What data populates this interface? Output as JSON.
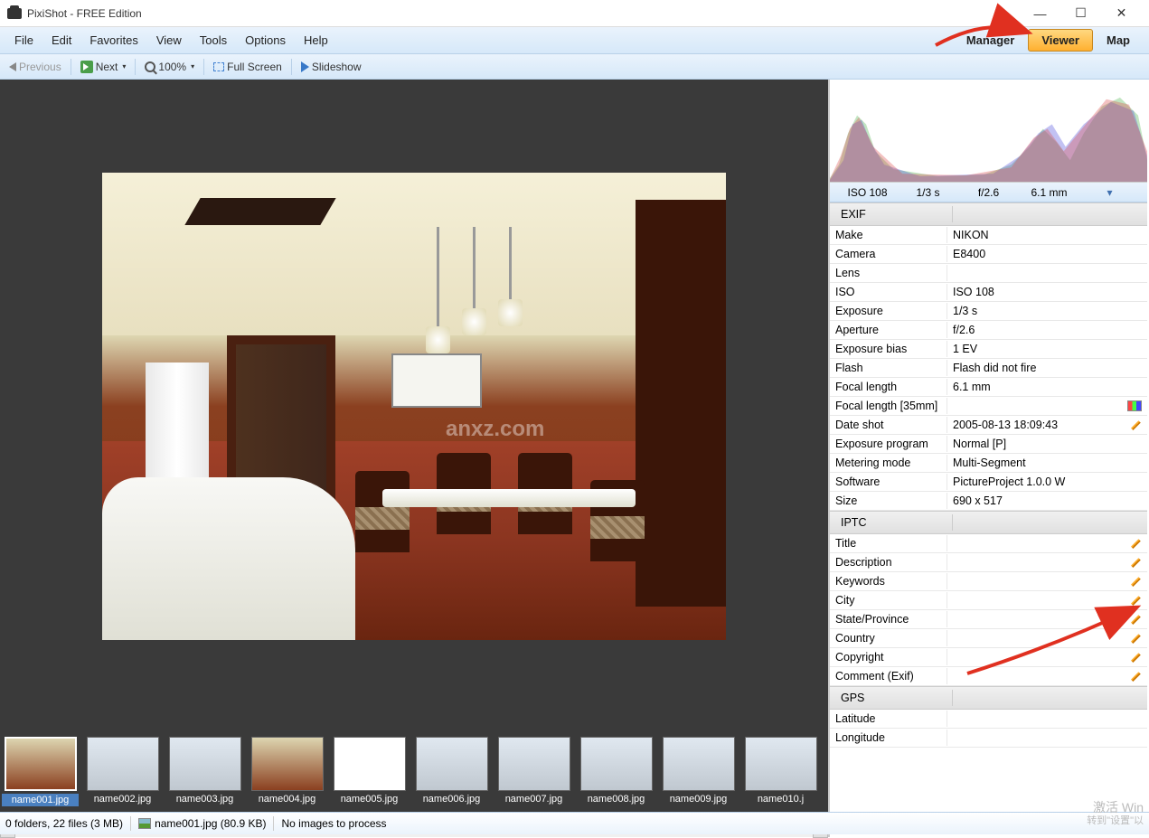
{
  "window": {
    "title": "PixiShot  -  FREE Edition"
  },
  "menu": {
    "items": [
      "File",
      "Edit",
      "Favorites",
      "View",
      "Tools",
      "Options",
      "Help"
    ]
  },
  "modes": {
    "manager": "Manager",
    "viewer": "Viewer",
    "map": "Map"
  },
  "toolbar": {
    "previous": "Previous",
    "next": "Next",
    "zoom": "100%",
    "fullscreen": "Full Screen",
    "slideshow": "Slideshow"
  },
  "exif_summary": {
    "iso": "ISO 108",
    "shutter": "1/3 s",
    "aperture": "f/2.6",
    "focal": "6.1 mm"
  },
  "metadata": {
    "sections": [
      {
        "name": "EXIF",
        "rows": [
          {
            "k": "Make",
            "v": "NIKON"
          },
          {
            "k": "Camera",
            "v": "E8400"
          },
          {
            "k": "Lens",
            "v": ""
          },
          {
            "k": "ISO",
            "v": "ISO 108"
          },
          {
            "k": "Exposure",
            "v": "1/3 s"
          },
          {
            "k": "Aperture",
            "v": "f/2.6"
          },
          {
            "k": "Exposure bias",
            "v": "1 EV"
          },
          {
            "k": "Flash",
            "v": "Flash did not fire"
          },
          {
            "k": "Focal length",
            "v": "6.1 mm"
          },
          {
            "k": "Focal length [35mm]",
            "v": "",
            "colorbox": true
          },
          {
            "k": "Date shot",
            "v": "2005-08-13 18:09:43",
            "edit": true
          },
          {
            "k": "Exposure program",
            "v": "Normal [P]"
          },
          {
            "k": "Metering mode",
            "v": "Multi-Segment"
          },
          {
            "k": "Software",
            "v": "PictureProject 1.0.0 W"
          },
          {
            "k": "Size",
            "v": "690 x 517"
          }
        ]
      },
      {
        "name": "IPTC",
        "rows": [
          {
            "k": "Title",
            "v": "",
            "edit": true
          },
          {
            "k": "Description",
            "v": "",
            "edit": true
          },
          {
            "k": "Keywords",
            "v": "",
            "edit": true
          },
          {
            "k": "City",
            "v": "",
            "edit": true
          },
          {
            "k": "State/Province",
            "v": "",
            "edit": true
          },
          {
            "k": "Country",
            "v": "",
            "edit": true
          },
          {
            "k": "Copyright",
            "v": "",
            "edit": true
          },
          {
            "k": "Comment (Exif)",
            "v": "",
            "edit": true
          }
        ]
      },
      {
        "name": "GPS",
        "rows": [
          {
            "k": "Latitude",
            "v": ""
          },
          {
            "k": "Longitude",
            "v": ""
          }
        ]
      }
    ]
  },
  "thumbnails": [
    {
      "label": "name001.jpg",
      "selected": true,
      "kind": "room"
    },
    {
      "label": "name002.jpg",
      "kind": "modern"
    },
    {
      "label": "name003.jpg",
      "kind": "modern"
    },
    {
      "label": "name004.jpg",
      "kind": "room"
    },
    {
      "label": "name005.jpg",
      "kind": "plan"
    },
    {
      "label": "name006.jpg",
      "kind": "modern"
    },
    {
      "label": "name007.jpg",
      "kind": "modern"
    },
    {
      "label": "name008.jpg",
      "kind": "modern"
    },
    {
      "label": "name009.jpg",
      "kind": "modern"
    },
    {
      "label": "name010.j",
      "kind": "modern"
    }
  ],
  "status": {
    "folders": "0 folders,  22 files  (3 MB)",
    "current": "name001.jpg  (80.9 KB)",
    "process": "No images to process"
  },
  "watermark_win": {
    "l1": "激活 Win",
    "l2": "转到\"设置\"以"
  }
}
